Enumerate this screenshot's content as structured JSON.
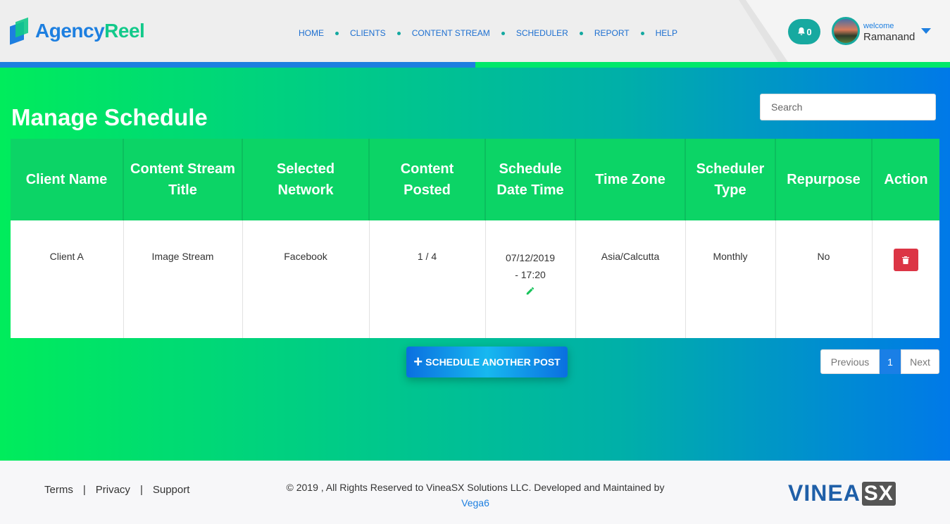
{
  "brand": {
    "name_part1": "Agency",
    "name_part2": "Reel"
  },
  "nav": {
    "items": [
      "HOME",
      "CLIENTS",
      "CONTENT STREAM",
      "SCHEDULER",
      "REPORT",
      "HELP"
    ]
  },
  "user": {
    "notification_count": "0",
    "welcome": "welcome",
    "name": "Ramanand"
  },
  "page": {
    "title": "Manage Schedule",
    "search_placeholder": "Search"
  },
  "table": {
    "headers": [
      "Client Name",
      "Content Stream Title",
      "Selected Network",
      "Content Posted",
      "Schedule Date Time",
      "Time Zone",
      "Scheduler Type",
      "Repurpose",
      "Action"
    ],
    "rows": [
      {
        "client_name": "Client A",
        "stream_title": "Image Stream",
        "network": "Facebook",
        "posted": "1 / 4",
        "date": "07/12/2019",
        "time": "- 17:20",
        "timezone": "Asia/Calcutta",
        "scheduler_type": "Monthly",
        "repurpose": "No"
      }
    ]
  },
  "actions": {
    "schedule_another": "SCHEDULE ANOTHER POST"
  },
  "pagination": {
    "previous": "Previous",
    "current": "1",
    "next": "Next"
  },
  "footer": {
    "links": [
      "Terms",
      "Privacy",
      "Support"
    ],
    "copyright": "© 2019 , All Rights Reserved to VineaSX Solutions LLC. Developed and Maintained by",
    "developer": "Vega6",
    "company_logo_part1": "VINEA",
    "company_logo_part2": "SX"
  },
  "colors": {
    "brand_blue": "#1d7fe0",
    "brand_green": "#12c98a",
    "header_green": "#0cd466",
    "danger": "#dc3545"
  }
}
